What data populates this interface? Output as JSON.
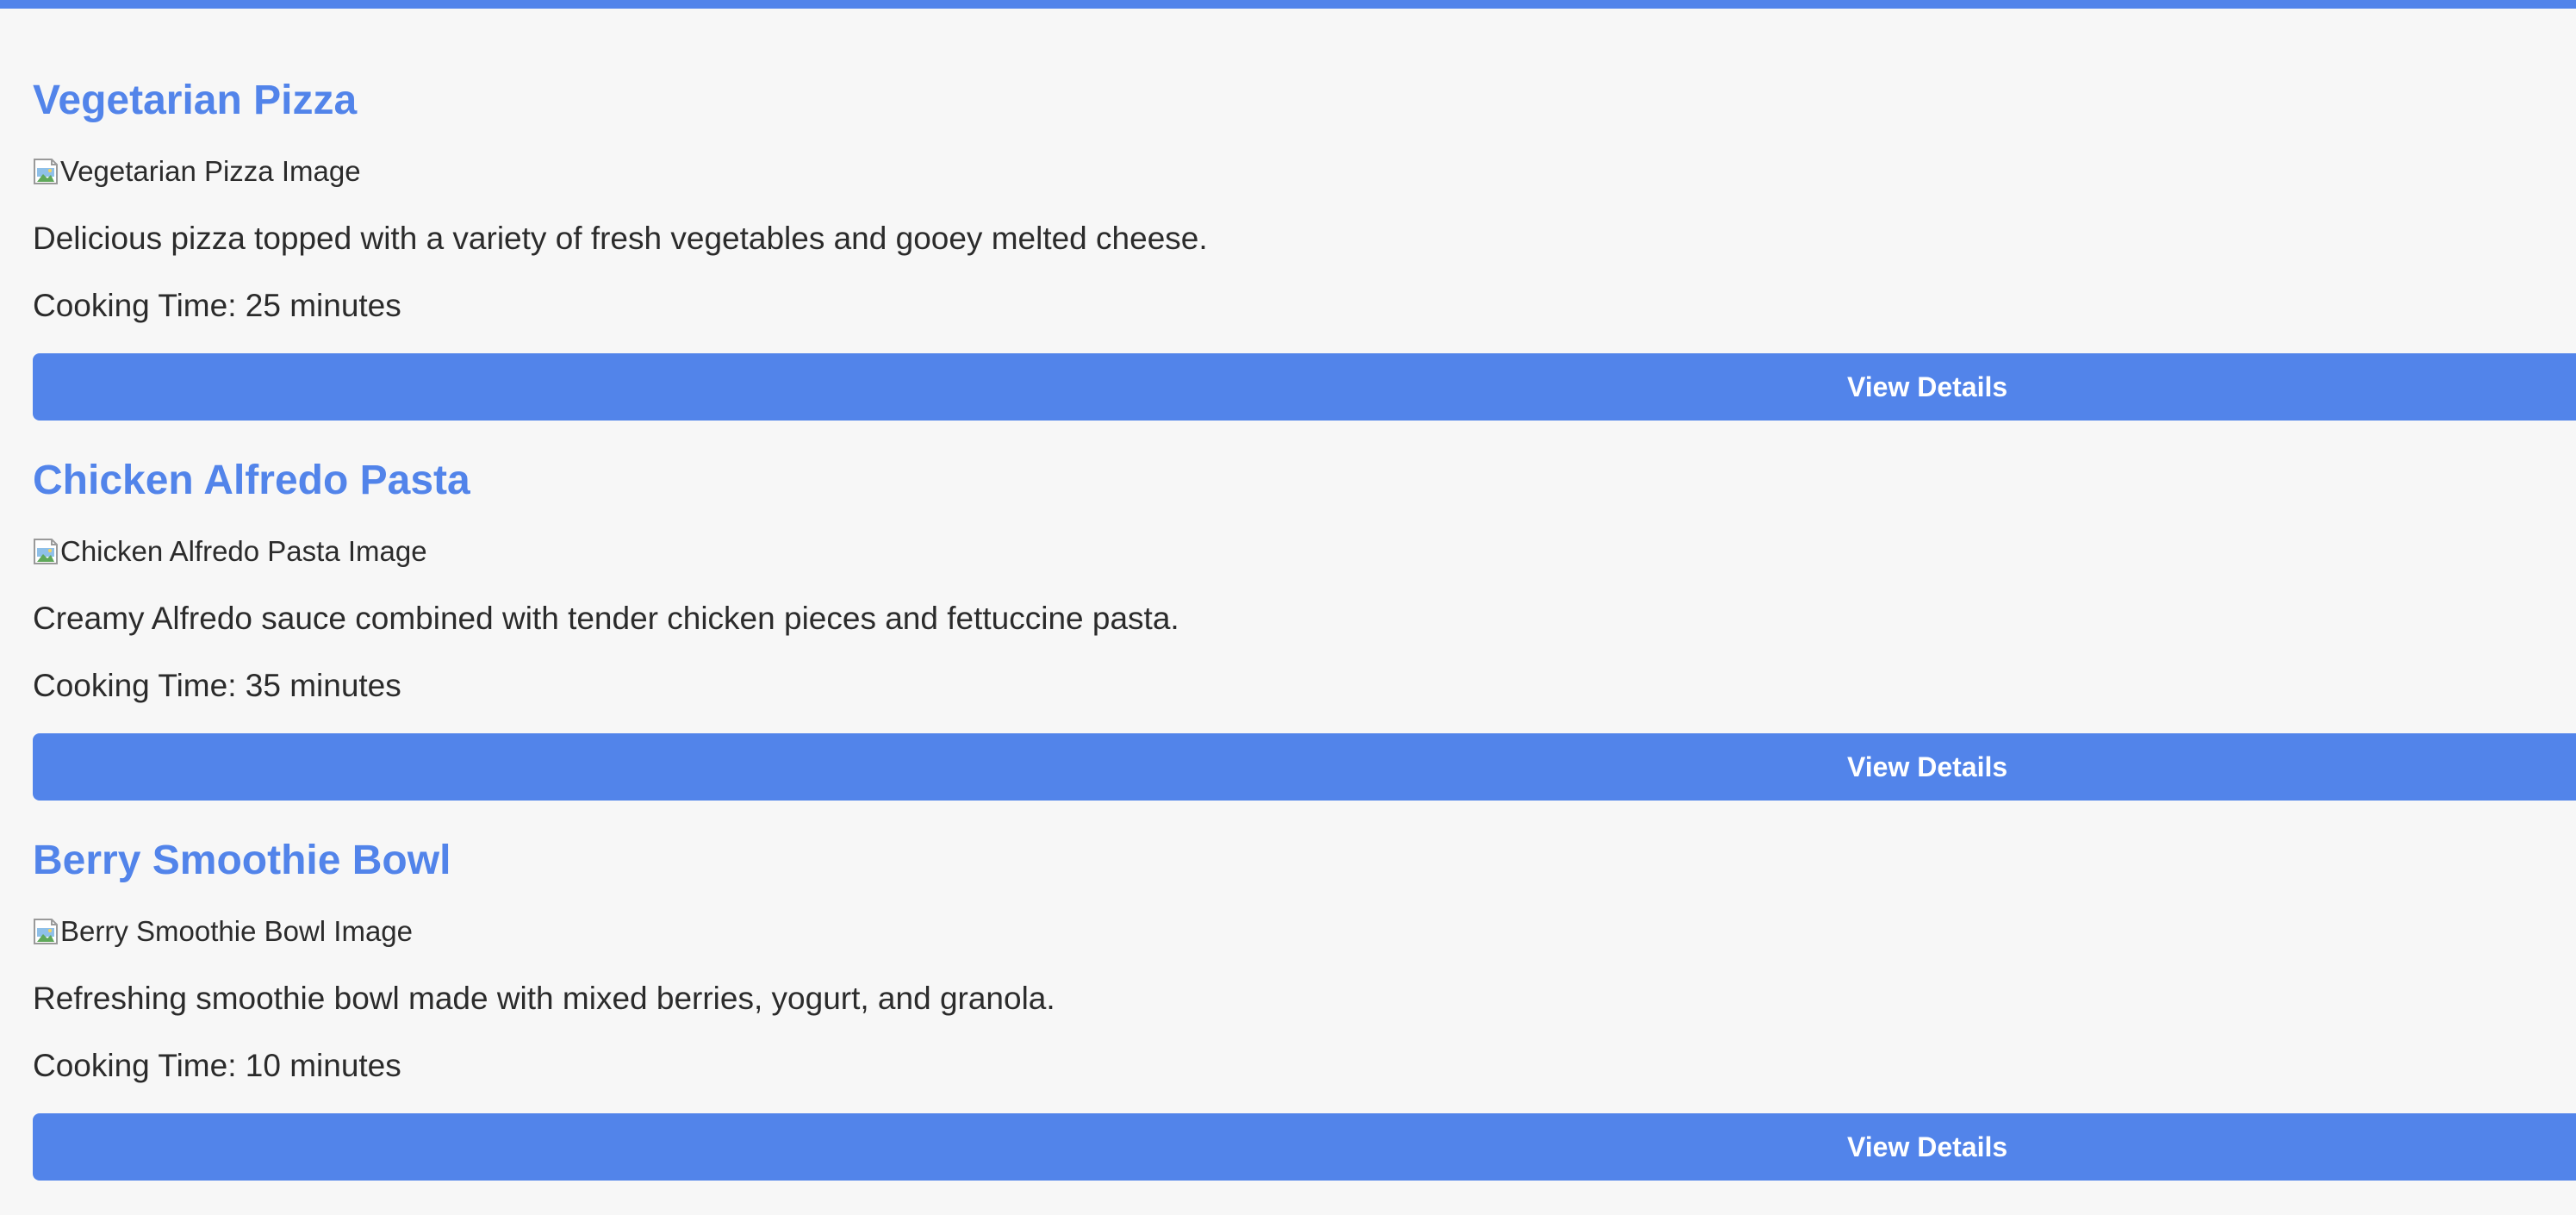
{
  "colors": {
    "accent": "#5284ea",
    "background": "#f7f7f7",
    "text": "#2b2b2b",
    "button_text": "#ffffff"
  },
  "recipes": [
    {
      "title": "Vegetarian Pizza",
      "image_alt": "Vegetarian Pizza Image",
      "description": "Delicious pizza topped with a variety of fresh vegetables and gooey melted cheese.",
      "cooking_time": "Cooking Time: 25 minutes",
      "button_label": "View Details"
    },
    {
      "title": "Chicken Alfredo Pasta",
      "image_alt": "Chicken Alfredo Pasta Image",
      "description": "Creamy Alfredo sauce combined with tender chicken pieces and fettuccine pasta.",
      "cooking_time": "Cooking Time: 35 minutes",
      "button_label": "View Details"
    },
    {
      "title": "Berry Smoothie Bowl",
      "image_alt": "Berry Smoothie Bowl Image",
      "description": "Refreshing smoothie bowl made with mixed berries, yogurt, and granola.",
      "cooking_time": "Cooking Time: 10 minutes",
      "button_label": "View Details"
    }
  ]
}
